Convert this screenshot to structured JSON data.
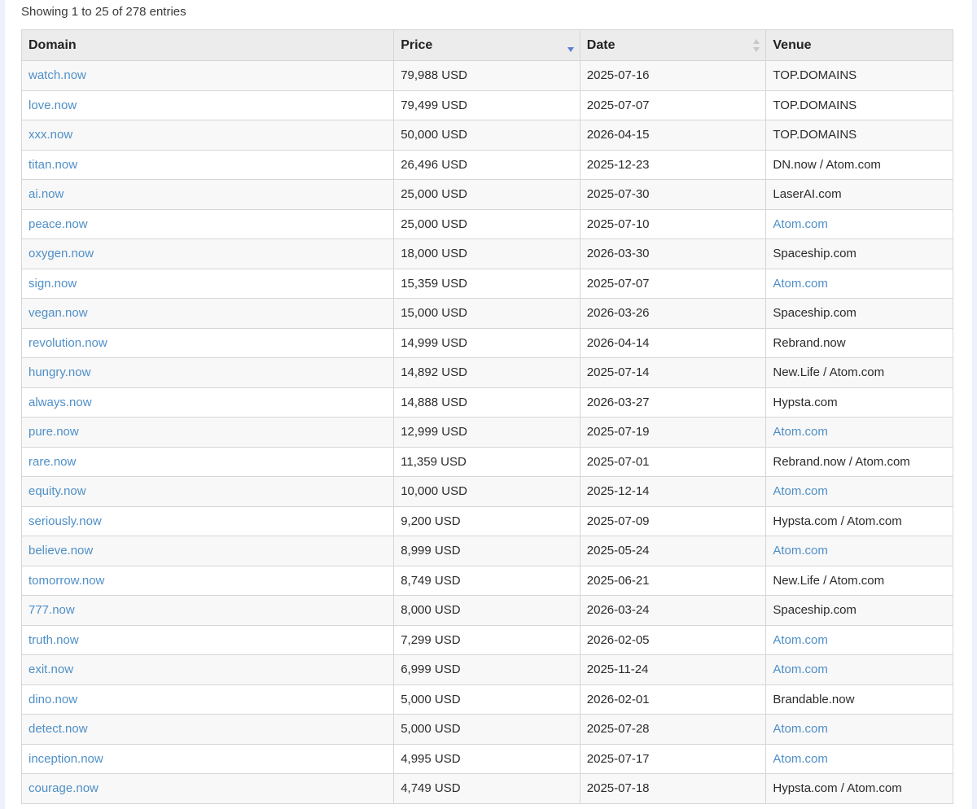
{
  "info_text": "Showing 1 to 25 of 278 entries",
  "columns": {
    "domain": "Domain",
    "price": "Price",
    "date": "Date",
    "venue": "Venue"
  },
  "sort": {
    "column": "price",
    "direction": "descending"
  },
  "colors": {
    "link": "#4f8fc7",
    "sort_active": "#5b7dd6",
    "sort_inactive": "#c8c8c8"
  },
  "rows": [
    {
      "domain": "watch.now",
      "price": "79,988 USD",
      "date": "2025-07-16",
      "venue": "TOP.DOMAINS",
      "venue_link": false
    },
    {
      "domain": "love.now",
      "price": "79,499 USD",
      "date": "2025-07-07",
      "venue": "TOP.DOMAINS",
      "venue_link": false
    },
    {
      "domain": "xxx.now",
      "price": "50,000 USD",
      "date": "2026-04-15",
      "venue": "TOP.DOMAINS",
      "venue_link": false
    },
    {
      "domain": "titan.now",
      "price": "26,496 USD",
      "date": "2025-12-23",
      "venue": "DN.now / Atom.com",
      "venue_link": false
    },
    {
      "domain": "ai.now",
      "price": "25,000 USD",
      "date": "2025-07-30",
      "venue": "LaserAI.com",
      "venue_link": false
    },
    {
      "domain": "peace.now",
      "price": "25,000 USD",
      "date": "2025-07-10",
      "venue": "Atom.com",
      "venue_link": true
    },
    {
      "domain": "oxygen.now",
      "price": "18,000 USD",
      "date": "2026-03-30",
      "venue": "Spaceship.com",
      "venue_link": false
    },
    {
      "domain": "sign.now",
      "price": "15,359 USD",
      "date": "2025-07-07",
      "venue": "Atom.com",
      "venue_link": true
    },
    {
      "domain": "vegan.now",
      "price": "15,000 USD",
      "date": "2026-03-26",
      "venue": "Spaceship.com",
      "venue_link": false
    },
    {
      "domain": "revolution.now",
      "price": "14,999 USD",
      "date": "2026-04-14",
      "venue": "Rebrand.now",
      "venue_link": false
    },
    {
      "domain": "hungry.now",
      "price": "14,892 USD",
      "date": "2025-07-14",
      "venue": "New.Life / Atom.com",
      "venue_link": false
    },
    {
      "domain": "always.now",
      "price": "14,888 USD",
      "date": "2026-03-27",
      "venue": "Hypsta.com",
      "venue_link": false
    },
    {
      "domain": "pure.now",
      "price": "12,999 USD",
      "date": "2025-07-19",
      "venue": "Atom.com",
      "venue_link": true
    },
    {
      "domain": "rare.now",
      "price": "11,359 USD",
      "date": "2025-07-01",
      "venue": "Rebrand.now / Atom.com",
      "venue_link": false
    },
    {
      "domain": "equity.now",
      "price": "10,000 USD",
      "date": "2025-12-14",
      "venue": "Atom.com",
      "venue_link": true
    },
    {
      "domain": "seriously.now",
      "price": "9,200 USD",
      "date": "2025-07-09",
      "venue": "Hypsta.com / Atom.com",
      "venue_link": false
    },
    {
      "domain": "believe.now",
      "price": "8,999 USD",
      "date": "2025-05-24",
      "venue": "Atom.com",
      "venue_link": true
    },
    {
      "domain": "tomorrow.now",
      "price": "8,749 USD",
      "date": "2025-06-21",
      "venue": "New.Life / Atom.com",
      "venue_link": false
    },
    {
      "domain": "777.now",
      "price": "8,000 USD",
      "date": "2026-03-24",
      "venue": "Spaceship.com",
      "venue_link": false
    },
    {
      "domain": "truth.now",
      "price": "7,299 USD",
      "date": "2026-02-05",
      "venue": "Atom.com",
      "venue_link": true
    },
    {
      "domain": "exit.now",
      "price": "6,999 USD",
      "date": "2025-11-24",
      "venue": "Atom.com",
      "venue_link": true
    },
    {
      "domain": "dino.now",
      "price": "5,000 USD",
      "date": "2026-02-01",
      "venue": "Brandable.now",
      "venue_link": false
    },
    {
      "domain": "detect.now",
      "price": "5,000 USD",
      "date": "2025-07-28",
      "venue": "Atom.com",
      "venue_link": true
    },
    {
      "domain": "inception.now",
      "price": "4,995 USD",
      "date": "2025-07-17",
      "venue": "Atom.com",
      "venue_link": true
    },
    {
      "domain": "courage.now",
      "price": "4,749 USD",
      "date": "2025-07-18",
      "venue": "Hypsta.com / Atom.com",
      "venue_link": false
    }
  ]
}
